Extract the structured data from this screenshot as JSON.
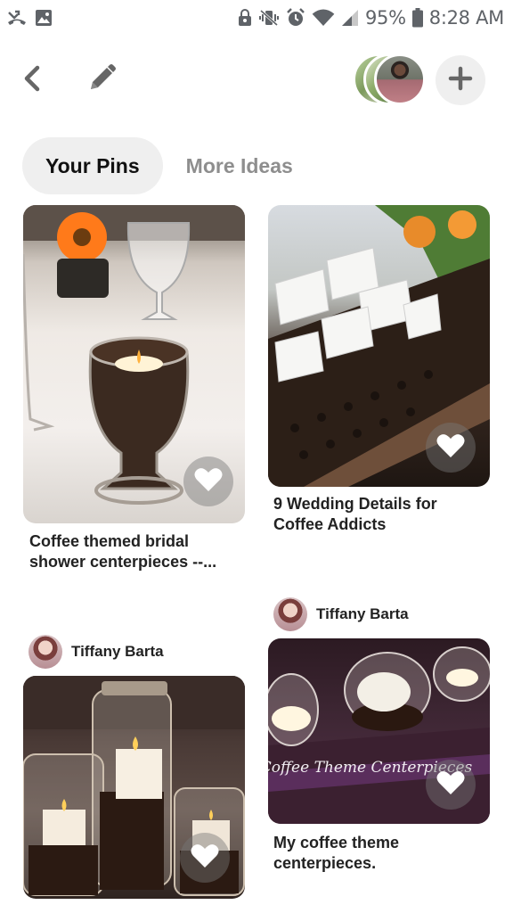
{
  "status_bar": {
    "icons_left": [
      "missed-call-icon",
      "image-icon"
    ],
    "icons_right": [
      "lock-icon",
      "vibrate-icon",
      "alarm-icon",
      "wifi-icon",
      "signal-icon"
    ],
    "battery": "95%",
    "time": "8:28 AM"
  },
  "toolbar": {
    "back_icon": "chevron-left-icon",
    "edit_icon": "pencil-icon",
    "add_icon": "plus-icon",
    "collaborator_count": 3
  },
  "tabs": [
    {
      "label": "Your Pins",
      "active": true
    },
    {
      "label": "More Ideas",
      "active": false
    }
  ],
  "pins": [
    {
      "title": "Coffee themed bridal shower centerpieces --...",
      "author": "",
      "image": "candle-coffee-bean-goblet"
    },
    {
      "title": "9 Wedding Details for Coffee Addicts",
      "author": "",
      "image": "place-cards-in-coffee-beans"
    },
    {
      "title": "",
      "author": "Tiffany Barta",
      "image": "mason-jar-candles"
    },
    {
      "title": "My coffee theme centerpieces.",
      "author": "Tiffany Barta",
      "image": "coffee-theme-centerpieces",
      "image_caption": "Coffee Theme Centerpieces"
    }
  ],
  "colors": {
    "tab_active_bg": "#efefef",
    "tab_inactive_text": "#8e8e8e",
    "icon_gray": "#666666"
  }
}
